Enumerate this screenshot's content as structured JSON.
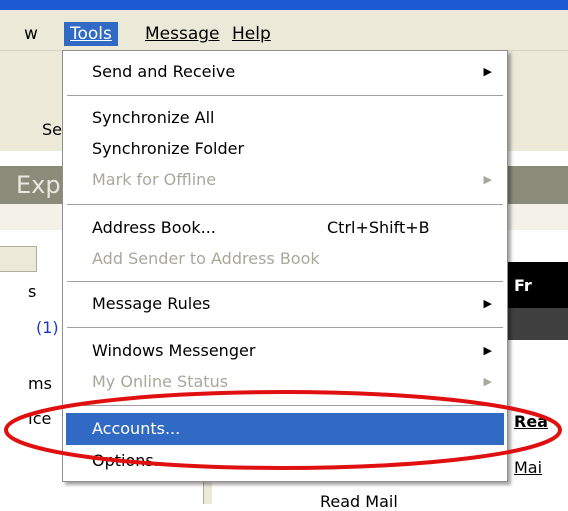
{
  "menubar": {
    "items": [
      {
        "label": "w"
      },
      {
        "label": "Tools",
        "active": true
      },
      {
        "label": "Message"
      },
      {
        "label": "Help"
      }
    ]
  },
  "background": {
    "toolbar_fragment": "Se",
    "banner_fragment": "Exp",
    "left_pane": {
      "s": "s",
      "count": "(1)",
      "ms": "ms",
      "ice": "Ice"
    },
    "right_pane": {
      "black_band_text": "Fr",
      "link_rea": "Rea",
      "link_mai": "Mai",
      "read_mail": "Read Mail"
    }
  },
  "dropdown": {
    "items": [
      {
        "label": "Send and Receive",
        "submenu": true,
        "disabled": false
      },
      {
        "label": "Synchronize All",
        "disabled": false
      },
      {
        "label": "Synchronize Folder",
        "disabled": false
      },
      {
        "label": "Mark for Offline",
        "submenu": true,
        "disabled": true
      },
      {
        "label": "Address Book...",
        "shortcut": "Ctrl+Shift+B",
        "disabled": false
      },
      {
        "label": "Add Sender to Address Book",
        "disabled": true
      },
      {
        "label": "Message Rules",
        "submenu": true,
        "disabled": false
      },
      {
        "label": "Windows Messenger",
        "submenu": true,
        "disabled": false
      },
      {
        "label": "My Online Status",
        "submenu": true,
        "disabled": true
      },
      {
        "label": "Accounts...",
        "disabled": false,
        "highlighted": true
      },
      {
        "label": "Options...",
        "disabled": false
      }
    ]
  },
  "colors": {
    "highlight": "#316ac5",
    "annotation": "#e01010",
    "menubar": "#ece9d8"
  }
}
